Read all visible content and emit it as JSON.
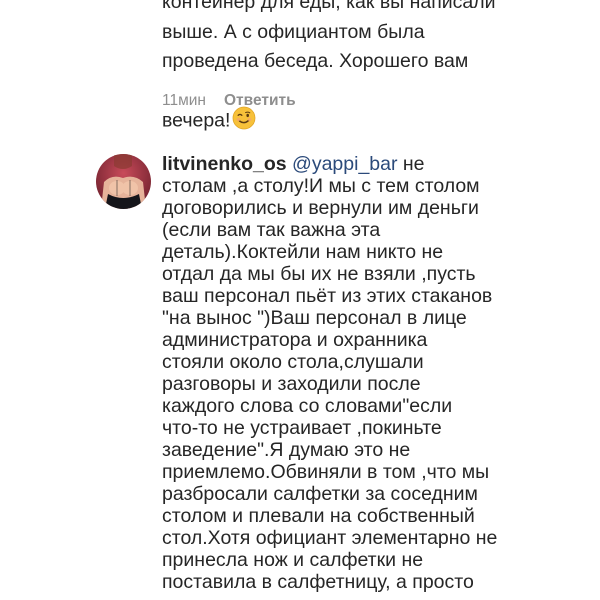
{
  "previous_comment": {
    "text": "контейнер для еды, как вы написали\nвыше. А с официантом была\nпроведена беседа. Хорошего вам\nвечера!",
    "emoji": "winking-face-emoji",
    "time": "11мин",
    "reply_label": "Ответить"
  },
  "comment": {
    "username": "litvinenko_os",
    "mention": "@yappi_bar",
    "text_first": " не",
    "text_rest": "столам ,а столу!И мы с тем столом\nдоговорились и вернули им деньги\n(если вам так важна эта\nдеталь).Коктейли нам никто не\nотдал да мы бы их не взяли ,пусть\nваш персонал пьёт из этих стаканов\n\"на вынос \")Ваш персонал в лице\nадминистратора и охранника\nстояли около стола,слушали\nразговоры и заходили после\nкаждого слова со словами\"если\nчто-то не устраивает ,покиньте\nзаведение\".Я думаю это не\nприемлемо.Обвиняли в том ,что мы\nразбросали салфетки за соседним\nстолом и плевали на собственный\nстол.Хотя официант элементарно не\nпринесла нож и салфетки не\nпоставила в салфетницу, а просто"
  }
}
